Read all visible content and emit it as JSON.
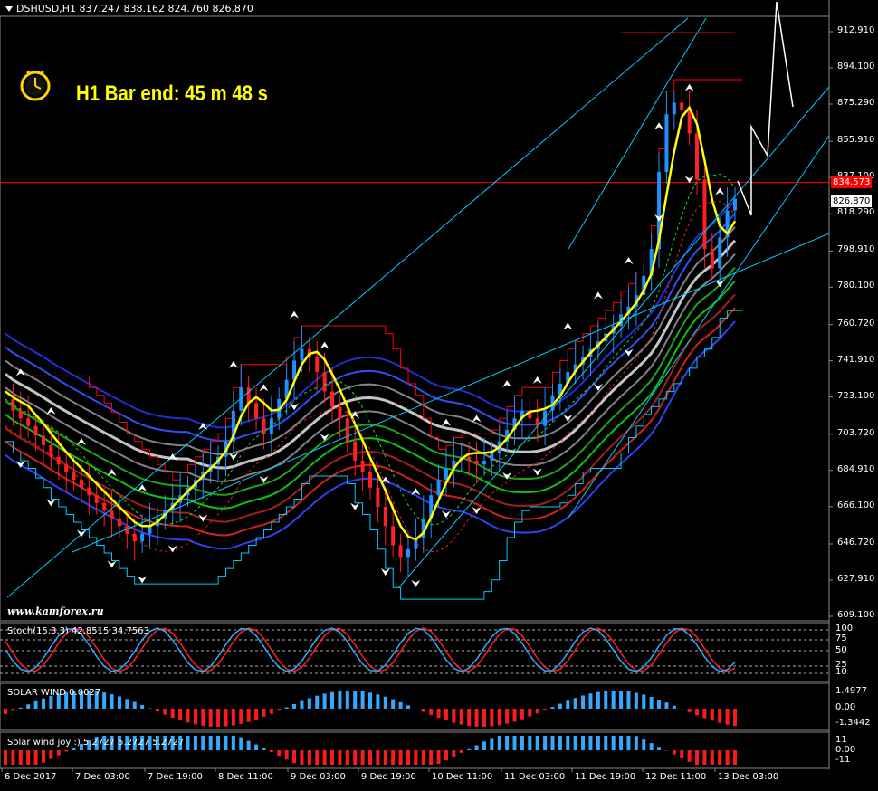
{
  "header": {
    "symbol_line": "DSHUSD,H1  837.247 838.162 824.760 826.870"
  },
  "timer": {
    "text": "H1 Bar end: 45 m 48 s"
  },
  "watermark": "www.kamforex.ru",
  "panels": {
    "stoch_label": "Stoch(15,3,3) 42.8515 34.7563",
    "solar_label": "SOLAR WIND 0.0027",
    "joy_label": "Solar wind joy :) 5.2727 5.2727 5.2727"
  },
  "colors": {
    "background": "#000000",
    "bull": "#1e90ff",
    "bear": "#ff2020",
    "envelope": "#ff0000",
    "trend": "#00ccff",
    "signal": "#ffff00",
    "oscillator_pos": "#33aaff",
    "oscillator_neg": "#ff1a1a"
  },
  "chart_data": {
    "type": "line",
    "price_axis_ticks": [
      "912.910",
      "894.100",
      "875.290",
      "855.910",
      "837.100",
      "818.290",
      "798.910",
      "780.100",
      "760.720",
      "741.910",
      "723.100",
      "703.720",
      "684.910",
      "666.100",
      "646.720",
      "627.910",
      "609.100"
    ],
    "price_axis_values": [
      912.91,
      894.1,
      875.29,
      855.91,
      837.1,
      818.29,
      798.91,
      780.1,
      760.72,
      741.91,
      723.1,
      703.72,
      684.91,
      666.1,
      646.72,
      627.91,
      609.1
    ],
    "current_price_tag": "826.870",
    "line_price_tag": "834.573",
    "line_price": 834.573,
    "current_price": 826.87,
    "time_labels": [
      "6 Dec 2017",
      "7 Dec 03:00",
      "7 Dec 19:00",
      "8 Dec 11:00",
      "9 Dec 03:00",
      "9 Dec 19:00",
      "10 Dec 11:00",
      "11 Dec 03:00",
      "11 Dec 19:00",
      "12 Dec 11:00",
      "13 Dec 03:00"
    ],
    "close_series": [
      722,
      716,
      712,
      708,
      703,
      698,
      692,
      688,
      684,
      680,
      676,
      672,
      668,
      664,
      660,
      656,
      652,
      648,
      652,
      656,
      660,
      664,
      668,
      672,
      676,
      680,
      684,
      688,
      692,
      700,
      716,
      728,
      720,
      712,
      704,
      712,
      722,
      732,
      742,
      748,
      744,
      736,
      726,
      718,
      712,
      700,
      690,
      684,
      676,
      666,
      656,
      646,
      640,
      644,
      650,
      660,
      672,
      680,
      686,
      690,
      692,
      690,
      688,
      690,
      694,
      700,
      706,
      712,
      716,
      712,
      708,
      716,
      724,
      730,
      736,
      740,
      744,
      748,
      752,
      756,
      760,
      766,
      770,
      776,
      786,
      800,
      840,
      870,
      876,
      872,
      860,
      836,
      800,
      790,
      806,
      820,
      826
    ],
    "stoch_axis_ticks": [
      "100",
      "75",
      "50",
      "25",
      "10"
    ],
    "solar_axis_ticks": [
      "1.4977",
      "0.00",
      "-1.3442"
    ],
    "joy_axis_ticks": [
      "11",
      "0.00",
      "-11"
    ]
  }
}
